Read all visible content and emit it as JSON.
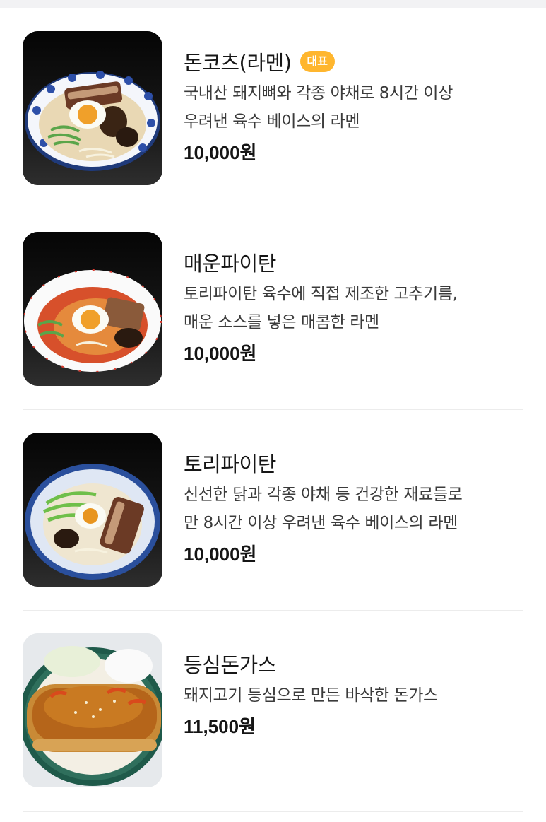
{
  "menu": {
    "items": [
      {
        "name": "돈코츠(라멘)",
        "badge": "대표",
        "description": "국내산 돼지뼈와 각종 야채로 8시간 이상\n우려낸 육수 베이스의 라멘",
        "price": "10,000원",
        "image_icon": "tonkotsu-ramen-photo"
      },
      {
        "name": "매운파이탄",
        "description": "토리파이탄 육수에 직접 제조한 고추기름,\n매운 소스를 넣은 매콤한 라멘",
        "price": "10,000원",
        "image_icon": "spicy-paitan-ramen-photo"
      },
      {
        "name": "토리파이탄",
        "description": "신선한 닭과 각종 야채 등 건강한 재료들로\n만 8시간 이상 우려낸 육수 베이스의 라멘",
        "price": "10,000원",
        "image_icon": "tori-paitan-ramen-photo"
      },
      {
        "name": "등심돈가스",
        "description": "돼지고기 등심으로 만든 바삭한 돈가스",
        "price": "11,500원",
        "image_icon": "pork-cutlet-photo"
      }
    ]
  },
  "colors": {
    "badge": "#ffb62e",
    "divider": "#ececec",
    "top_strip": "#f2f2f4"
  }
}
